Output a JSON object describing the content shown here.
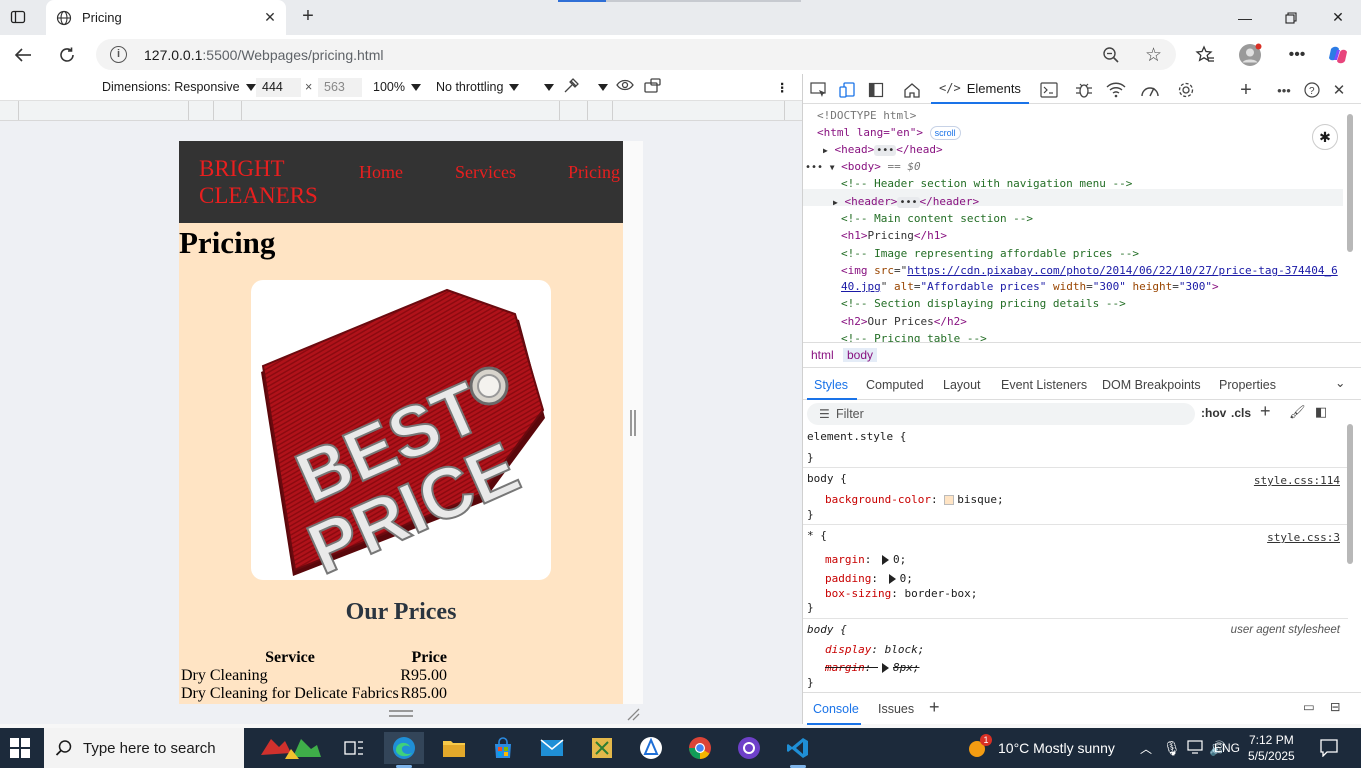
{
  "browser": {
    "tab_title": "Pricing",
    "url_host": "127.0.0.1",
    "url_path": ":5500/Webpages/pricing.html"
  },
  "device_bar": {
    "dimensions_label": "Dimensions: Responsive",
    "width": "444",
    "height": "563",
    "zoom": "100%",
    "throttling": "No throttling"
  },
  "site": {
    "logo_line1": "BRIGHT",
    "logo_line2": "CLEANERS",
    "nav": [
      "Home",
      "Services",
      "Pricing"
    ],
    "h1": "Pricing",
    "image_text_1": "BEST",
    "image_text_2": "PRICE",
    "h2": "Our Prices",
    "table": {
      "headers": [
        "Service",
        "Price"
      ],
      "rows": [
        [
          "Dry Cleaning",
          "R95.00"
        ],
        [
          "Dry Cleaning for Delicate Fabrics",
          "R85.00"
        ]
      ]
    }
  },
  "devtools": {
    "main_tab": "Elements",
    "dom": {
      "doctype": "<!DOCTYPE html>",
      "html_open": "<html lang=\"en\">",
      "scroll_badge": "scroll",
      "head": "<head>",
      "head_close": "</head>",
      "body": "<body>",
      "body_marker": "== $0",
      "c1": "<!-- Header section with navigation menu -->",
      "header": "<header>",
      "header_close": "</header>",
      "c2": "<!-- Main content section -->",
      "h1_open": "<h1>",
      "h1_text": "Pricing",
      "h1_close": "</h1>",
      "c3": "<!-- Image representing affordable prices -->",
      "img_open": "<img ",
      "src_attr": "src",
      "src_val_1": "https://cdn.pixabay.com/photo/2014/06/22/10/27/price-tag-374404_6",
      "src_val_2": "40.jpg",
      "alt_attr": "alt",
      "alt_val": "\"Affordable prices\"",
      "width_attr": "width",
      "width_val": "\"300\"",
      "height_attr": "height",
      "height_val": "\"300\"",
      "c4": "<!-- Section displaying pricing details -->",
      "h2_open": "<h2>",
      "h2_text": "Our Prices",
      "h2_close": "</h2>",
      "c5": "<!-- Pricing table -->"
    },
    "breadcrumbs": [
      "html",
      "body"
    ],
    "subtabs": [
      "Styles",
      "Computed",
      "Layout",
      "Event Listeners",
      "DOM Breakpoints",
      "Properties"
    ],
    "filter_placeholder": "Filter",
    "hov": ":hov",
    "cls": ".cls",
    "styles": {
      "element_style": "element.style {",
      "close_brace": "}",
      "body_sel": "body {",
      "body_src": "style.css:114",
      "bg_prop": "background-color",
      "bg_val": "bisque;",
      "star_sel": "* {",
      "star_src": "style.css:3",
      "margin_prop": "margin",
      "margin_val": "0;",
      "padding_prop": "padding",
      "padding_val": "0;",
      "boxsizing_prop": "box-sizing",
      "boxsizing_val": "border-box;",
      "ua_sel": "body {",
      "ua_src": "user agent stylesheet",
      "display_prop": "display",
      "display_val": "block;",
      "ua_margin_prop": "margin",
      "ua_margin_val": "8px;"
    },
    "drawer_tabs": [
      "Console",
      "Issues"
    ]
  },
  "taskbar": {
    "search_placeholder": "Type here to search",
    "weather": "10°C  Mostly sunny",
    "lang": "ENG",
    "time": "7:12 PM",
    "date": "5/5/2025",
    "weather_badge": "1"
  }
}
